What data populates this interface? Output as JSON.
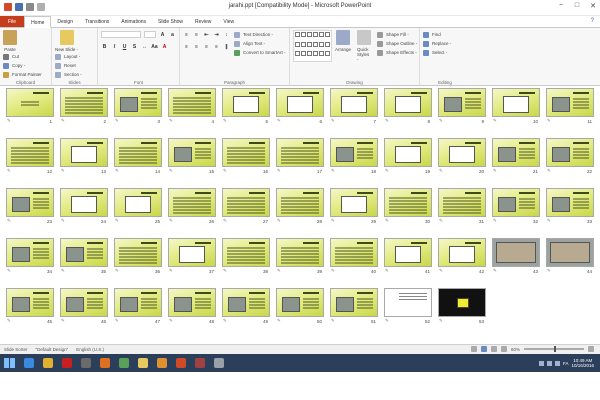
{
  "window": {
    "title": "jarahi.ppt [Compatibility Mode] - Microsoft PowerPoint",
    "min": "−",
    "max": "□",
    "close": "✕"
  },
  "tabs": [
    {
      "label": "File",
      "kind": "file"
    },
    {
      "label": "Home",
      "kind": "active"
    },
    {
      "label": "Design",
      "kind": ""
    },
    {
      "label": "Transitions",
      "kind": ""
    },
    {
      "label": "Animations",
      "kind": ""
    },
    {
      "label": "Slide Show",
      "kind": ""
    },
    {
      "label": "Review",
      "kind": ""
    },
    {
      "label": "View",
      "kind": ""
    }
  ],
  "ribbon": {
    "clipboard": {
      "paste": "Paste",
      "cut": "Cut",
      "copy": "Copy -",
      "format_painter": "Format Painter",
      "label": "Clipboard"
    },
    "slides": {
      "new_slide": "New Slide -",
      "layout": "Layout -",
      "reset": "Reset",
      "section": "Section -",
      "label": "Slides"
    },
    "font": {
      "label": "Font"
    },
    "paragraph": {
      "text_direction": "Text Direction -",
      "align_text": "Align Text -",
      "smartart": "Convert to SmartArt -",
      "label": "Paragraph"
    },
    "drawing": {
      "arrange": "Arrange",
      "quick_styles": "Quick Styles -",
      "shape_fill": "Shape Fill -",
      "shape_outline": "Shape Outline -",
      "shape_effects": "Shape Effects -",
      "label": "Drawing"
    },
    "editing": {
      "find": "Find",
      "replace": "Replace -",
      "select": "Select -",
      "label": "Editing"
    }
  },
  "slides": [
    {
      "num": "1",
      "kind": "title"
    },
    {
      "num": "2",
      "kind": "text"
    },
    {
      "num": "3",
      "kind": "img"
    },
    {
      "num": "4",
      "kind": "text"
    },
    {
      "num": "5",
      "kind": "diag"
    },
    {
      "num": "6",
      "kind": "diag"
    },
    {
      "num": "7",
      "kind": "diag"
    },
    {
      "num": "8",
      "kind": "diag"
    },
    {
      "num": "9",
      "kind": "img"
    },
    {
      "num": "10",
      "kind": "diag"
    },
    {
      "num": "11",
      "kind": "img"
    },
    {
      "num": "12",
      "kind": "text"
    },
    {
      "num": "13",
      "kind": "diag"
    },
    {
      "num": "14",
      "kind": "text"
    },
    {
      "num": "15",
      "kind": "img"
    },
    {
      "num": "16",
      "kind": "text"
    },
    {
      "num": "17",
      "kind": "text"
    },
    {
      "num": "18",
      "kind": "img"
    },
    {
      "num": "19",
      "kind": "diag"
    },
    {
      "num": "20",
      "kind": "diag"
    },
    {
      "num": "21",
      "kind": "img"
    },
    {
      "num": "22",
      "kind": "img"
    },
    {
      "num": "23",
      "kind": "img"
    },
    {
      "num": "24",
      "kind": "diag"
    },
    {
      "num": "25",
      "kind": "diag"
    },
    {
      "num": "26",
      "kind": "text"
    },
    {
      "num": "27",
      "kind": "text"
    },
    {
      "num": "28",
      "kind": "text"
    },
    {
      "num": "29",
      "kind": "diag"
    },
    {
      "num": "30",
      "kind": "text"
    },
    {
      "num": "31",
      "kind": "text"
    },
    {
      "num": "32",
      "kind": "img"
    },
    {
      "num": "33",
      "kind": "img"
    },
    {
      "num": "34",
      "kind": "img"
    },
    {
      "num": "35",
      "kind": "img"
    },
    {
      "num": "36",
      "kind": "text"
    },
    {
      "num": "37",
      "kind": "diag"
    },
    {
      "num": "38",
      "kind": "text"
    },
    {
      "num": "39",
      "kind": "text"
    },
    {
      "num": "40",
      "kind": "text"
    },
    {
      "num": "41",
      "kind": "diag"
    },
    {
      "num": "42",
      "kind": "diag"
    },
    {
      "num": "43",
      "kind": "photo"
    },
    {
      "num": "44",
      "kind": "photo"
    },
    {
      "num": "45",
      "kind": "img"
    },
    {
      "num": "46",
      "kind": "img"
    },
    {
      "num": "47",
      "kind": "img"
    },
    {
      "num": "48",
      "kind": "img"
    },
    {
      "num": "49",
      "kind": "img"
    },
    {
      "num": "50",
      "kind": "img"
    },
    {
      "num": "51",
      "kind": "img"
    },
    {
      "num": "52",
      "kind": "white"
    },
    {
      "num": "53",
      "kind": "black"
    }
  ],
  "status": {
    "view": "Slide Sorter",
    "theme": "\"Default Design\"",
    "language": "English (U.S.)",
    "zoom": "60%"
  },
  "taskbar": {
    "apps": [
      {
        "name": "ie",
        "color": "#3a8be0"
      },
      {
        "name": "chrome",
        "color": "#e0b030"
      },
      {
        "name": "acrobat",
        "color": "#c82020"
      },
      {
        "name": "app4",
        "color": "#6a6a6a"
      },
      {
        "name": "firefox",
        "color": "#e07020"
      },
      {
        "name": "media",
        "color": "#5aa05a"
      },
      {
        "name": "folder",
        "color": "#e8c860"
      },
      {
        "name": "media2",
        "color": "#e09030"
      },
      {
        "name": "powerpoint",
        "color": "#d04a2a"
      },
      {
        "name": "app10",
        "color": "#a04040"
      },
      {
        "name": "app11",
        "color": "#9aa0aa"
      }
    ],
    "lang": "FA",
    "time": "10:49 AM",
    "date": "10/16/2016"
  }
}
